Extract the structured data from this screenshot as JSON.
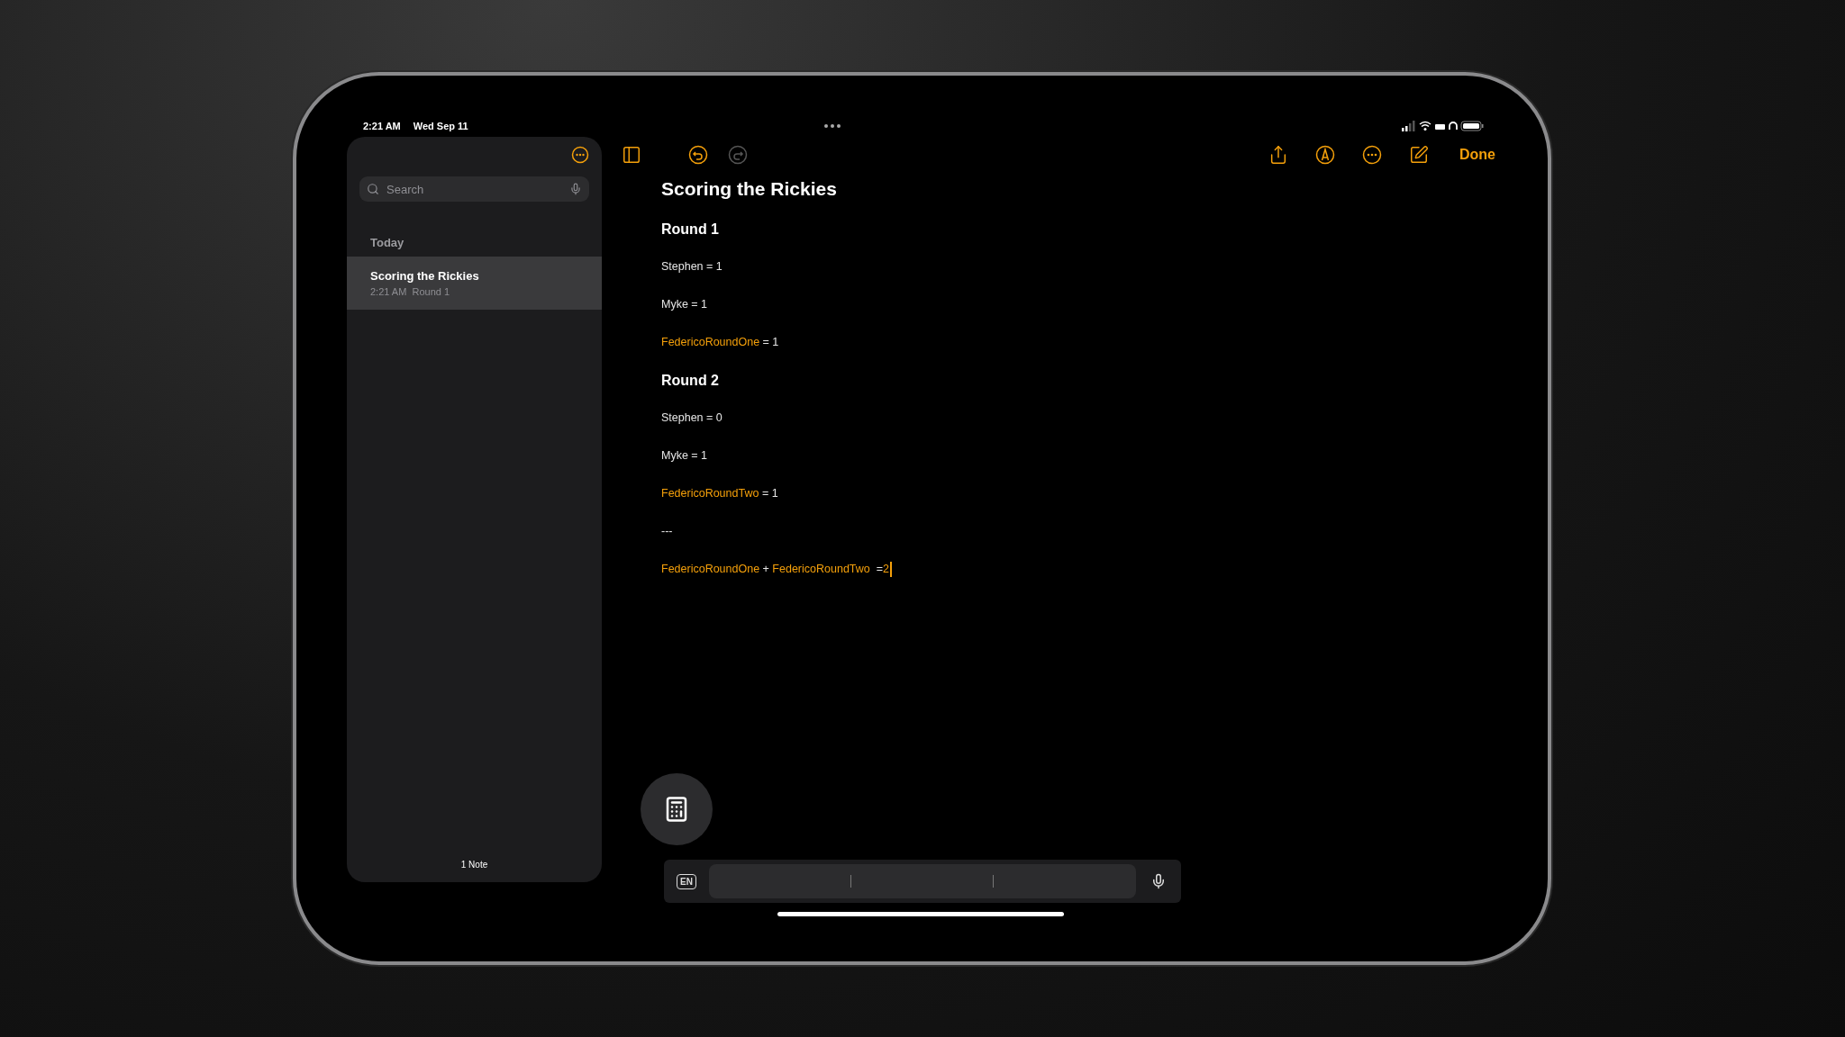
{
  "status_bar": {
    "time": "2:21 AM",
    "date": "Wed Sep 11"
  },
  "sidebar": {
    "search": {
      "placeholder": "Search"
    },
    "section": "Today",
    "notes": [
      {
        "title": "Scoring the Rickies",
        "time": "2:21 AM",
        "preview": "Round 1",
        "selected": true
      }
    ],
    "footer": "1 Note"
  },
  "toolbar": {
    "undo": {
      "disabled": false
    },
    "redo": {
      "disabled": true
    },
    "done": "Done"
  },
  "note": {
    "title": "Scoring the Rickies",
    "blocks": [
      {
        "kind": "heading",
        "text": "Round 1",
        "cursor": false
      },
      {
        "kind": "line",
        "cursor": false,
        "segments": [
          {
            "kind": "text",
            "text": "Stephen = 1"
          }
        ]
      },
      {
        "kind": "line",
        "cursor": false,
        "segments": [
          {
            "kind": "text",
            "text": "Myke = 1"
          }
        ]
      },
      {
        "kind": "line",
        "cursor": false,
        "segments": [
          {
            "kind": "variable",
            "text": "FedericoRoundOne"
          },
          {
            "kind": "text",
            "text": " = 1"
          }
        ]
      },
      {
        "kind": "heading",
        "text": "Round 2",
        "cursor": false
      },
      {
        "kind": "line",
        "cursor": false,
        "segments": [
          {
            "kind": "text",
            "text": "Stephen = 0"
          }
        ]
      },
      {
        "kind": "line",
        "cursor": false,
        "segments": [
          {
            "kind": "text",
            "text": "Myke = 1"
          }
        ]
      },
      {
        "kind": "line",
        "cursor": false,
        "segments": [
          {
            "kind": "variable",
            "text": "FedericoRoundTwo"
          },
          {
            "kind": "text",
            "text": " = 1"
          }
        ]
      },
      {
        "kind": "line",
        "cursor": false,
        "segments": [
          {
            "kind": "text",
            "text": "---"
          }
        ]
      },
      {
        "kind": "line",
        "cursor": true,
        "segments": [
          {
            "kind": "variable",
            "text": "FedericoRoundOne"
          },
          {
            "kind": "text",
            "text": " + "
          },
          {
            "kind": "variable",
            "text": "FedericoRoundTwo"
          },
          {
            "kind": "text",
            "text": "  ="
          },
          {
            "kind": "result",
            "text": "2"
          }
        ]
      }
    ]
  },
  "keyboard_bar": {
    "language": "EN"
  }
}
